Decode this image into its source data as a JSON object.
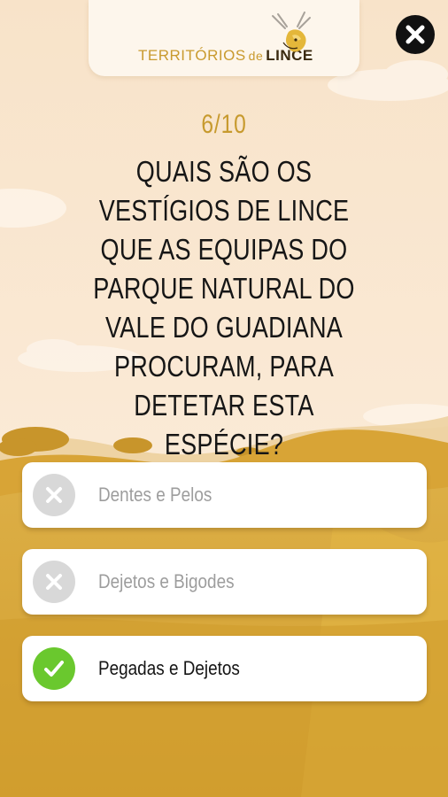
{
  "header": {
    "logo_territorios": "TERRITÓRIOS",
    "logo_de": "de",
    "logo_lince": "LINCE",
    "logo_icon": "lynx-emblem-icon",
    "close_icon": "close-icon"
  },
  "quiz": {
    "progress": "6/10",
    "current_question": 6,
    "total_questions": 10,
    "question": "QUAIS SÃO OS VESTÍGIOS DE LINCE QUE AS EQUIPAS DO PARQUE NATURAL DO VALE DO GUADIANA PROCURAM, PARA DETETAR ESTA ESPÉCIE?",
    "answers": [
      {
        "label": "Dentes e Pelos",
        "state": "wrong",
        "icon": "cross-icon"
      },
      {
        "label": "Dejetos e Bigodes",
        "state": "wrong",
        "icon": "cross-icon"
      },
      {
        "label": "Pegadas e Dejetos",
        "state": "correct",
        "icon": "check-icon"
      }
    ]
  },
  "colors": {
    "accent_gold": "#c79a2e",
    "correct_green": "#6ac82e",
    "wrong_gray": "#d8d8d8",
    "sky": "#fbe9d4",
    "ground": "#d9a52e"
  }
}
